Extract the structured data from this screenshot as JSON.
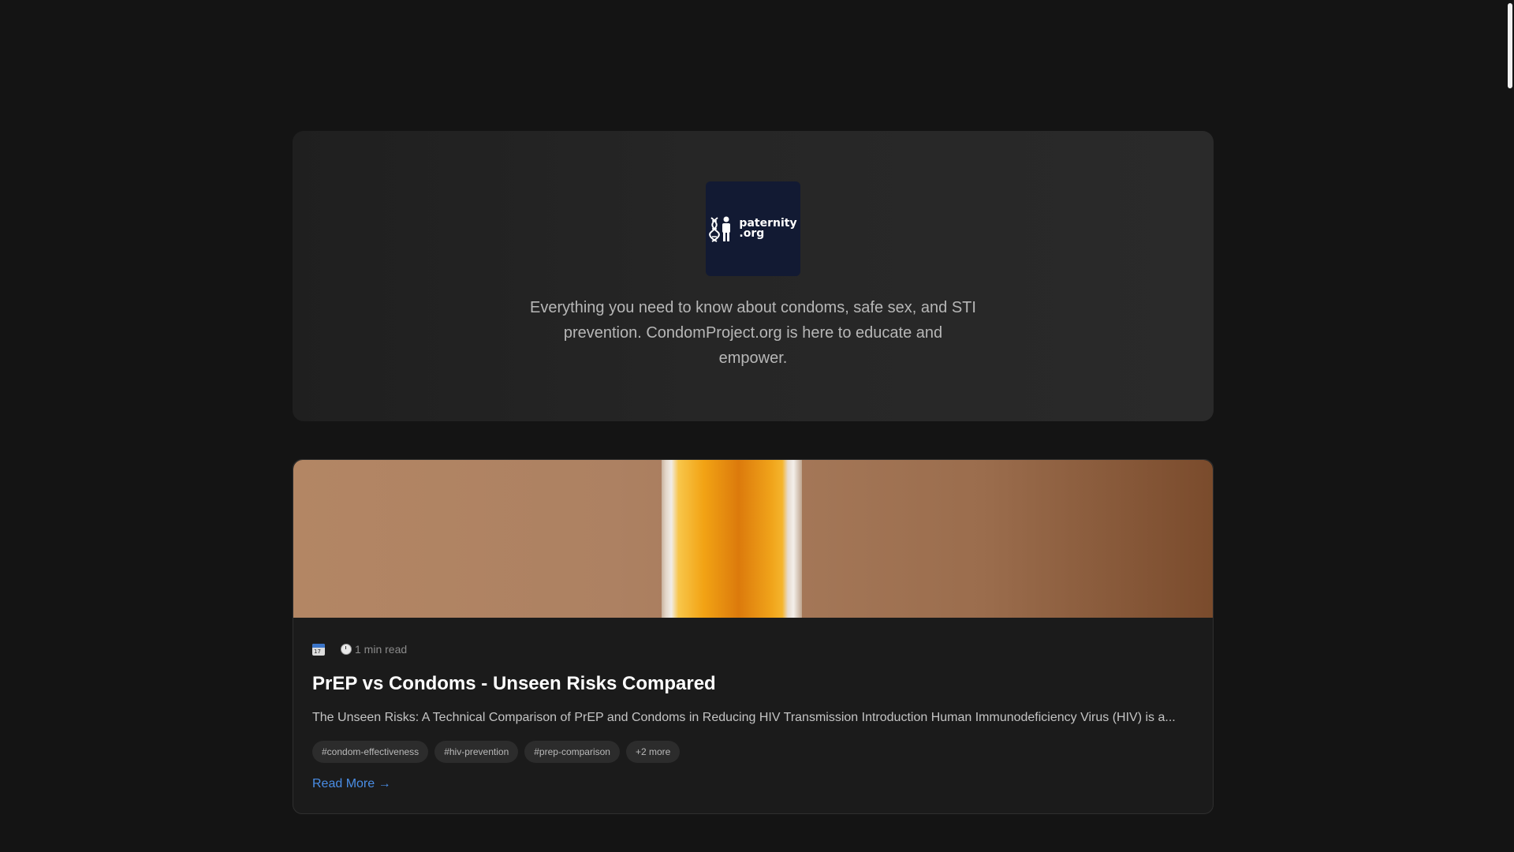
{
  "hero": {
    "logo_alt": "paternity.org",
    "logo_line1": "paternity",
    "logo_line2": ".org",
    "tagline": "Everything you need to know about condoms, safe sex, and STI prevention. CondomProject.org is here to educate and empower."
  },
  "posts": [
    {
      "date": "",
      "read_time": "1 min read",
      "title": "PrEP vs Condoms - Unseen Risks Compared",
      "excerpt": "The Unseen Risks: A Technical Comparison of PrEP and Condoms in Reducing HIV Transmission Introduction Human Immunodeficiency Virus (HIV) is a...",
      "tags": [
        "#condom-effectiveness",
        "#hiv-prevention",
        "#prep-comparison",
        "+2 more"
      ],
      "read_more": "Read More →"
    }
  ],
  "icons": {
    "calendar": "calendar-icon",
    "clock": "stopwatch-icon"
  },
  "colors": {
    "background": "#141414",
    "card": "#1b1b1b",
    "link": "#4a8ee6",
    "logo_bg": "#121a33"
  }
}
